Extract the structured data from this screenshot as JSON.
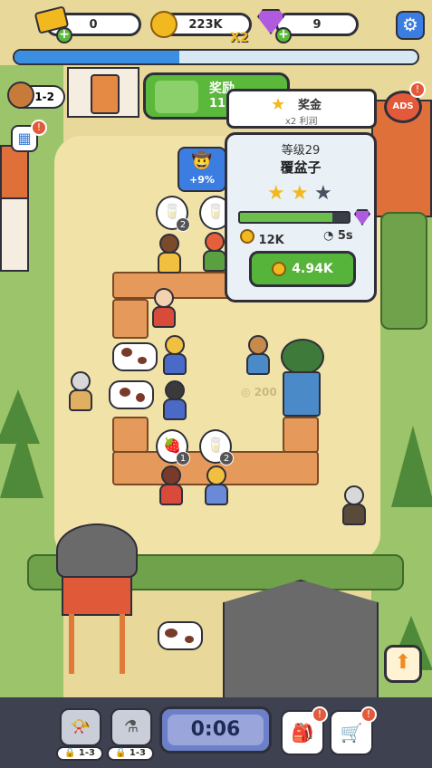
{
  "top_bar": {
    "tickets": "0",
    "coins": "223K",
    "multiplier": "X2",
    "gems": "9",
    "level_progress": 0.41
  },
  "player": {
    "stage": "1-2"
  },
  "reward": {
    "title": "奖励",
    "value": "118"
  },
  "bonus": {
    "title": "奖金",
    "subtitle": "x2 利润"
  },
  "ads": {
    "label": "ADS"
  },
  "item_card": {
    "level": "等级29",
    "name": "覆盆子",
    "stars_filled": 2,
    "stars_total": 3,
    "progress": 0.85,
    "revenue": "12K",
    "time": "5s",
    "upgrade_price": "4.94K"
  },
  "hat_bonus": "+9%",
  "ghost_price": "200",
  "bubbles": [
    {
      "icon": "milk-icon",
      "count": "2"
    },
    {
      "icon": "milk-icon",
      "count": ""
    },
    {
      "icon": "raspberry-icon",
      "count": "1"
    },
    {
      "icon": "milk-icon",
      "count": "2"
    }
  ],
  "footer": {
    "tool1_lock": "1-3",
    "tool2_lock": "1-3",
    "timer": "0:06"
  },
  "colors": {
    "accent_green": "#56b43a",
    "accent_blue": "#3c8ee0",
    "notify_red": "#e25a3a"
  }
}
